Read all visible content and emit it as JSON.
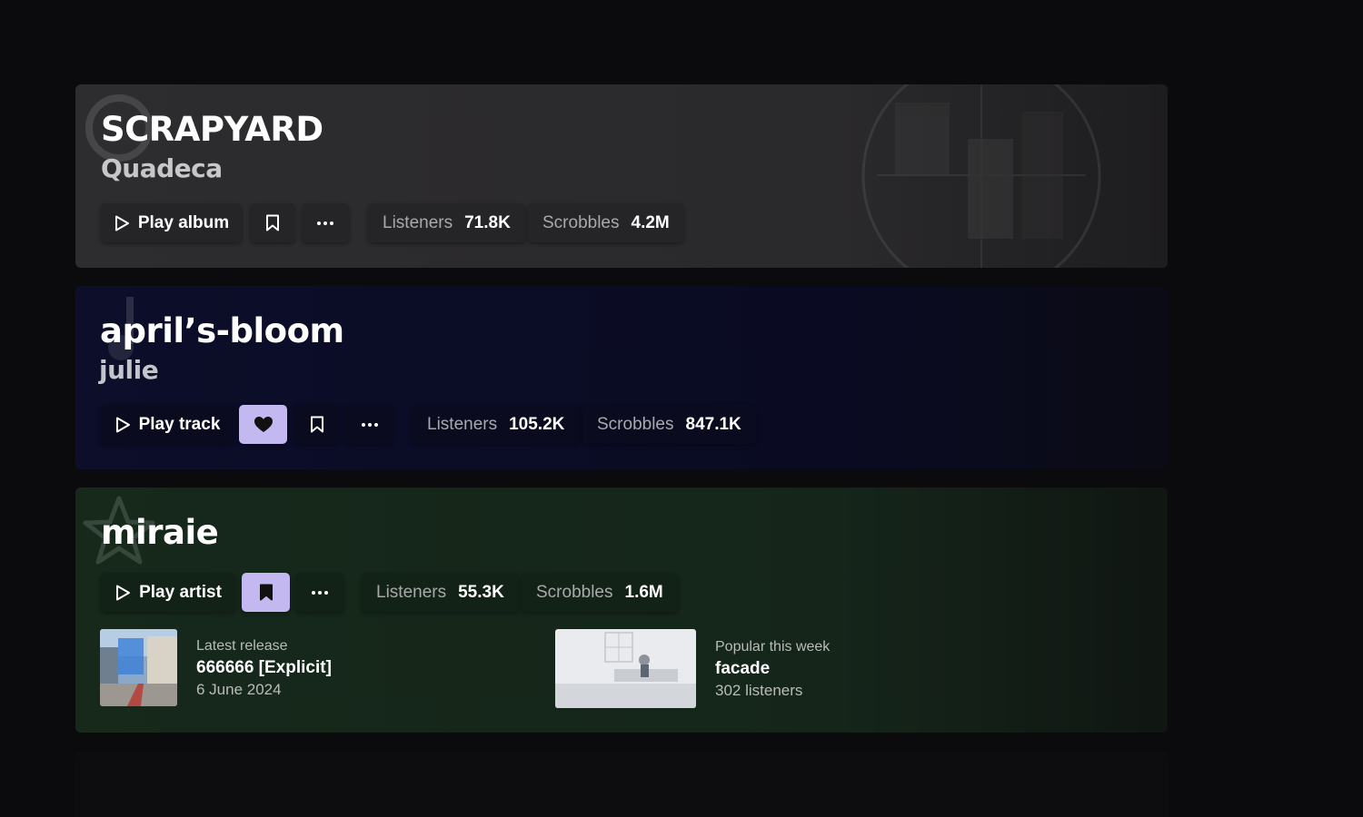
{
  "album_card": {
    "title": "SCRAPYARD",
    "artist": "Quadeca",
    "play_label": "Play album",
    "stats": [
      {
        "label": "Listeners",
        "value": "71.8K"
      },
      {
        "label": "Scrobbles",
        "value": "4.2M"
      }
    ],
    "icons": [
      "play-icon",
      "bookmark-icon",
      "more-icon"
    ]
  },
  "track_card": {
    "title": "april’s-bloom",
    "artist": "julie",
    "play_label": "Play track",
    "loved": true,
    "stats": [
      {
        "label": "Listeners",
        "value": "105.2K"
      },
      {
        "label": "Scrobbles",
        "value": "847.1K"
      }
    ],
    "icons": [
      "play-icon",
      "heart-icon",
      "bookmark-icon",
      "more-icon"
    ]
  },
  "artist_card": {
    "title": "miraie",
    "play_label": "Play artist",
    "bookmarked": true,
    "stats": [
      {
        "label": "Listeners",
        "value": "55.3K"
      },
      {
        "label": "Scrobbles",
        "value": "1.6M"
      }
    ],
    "latest_release": {
      "label": "Latest release",
      "name": "666666 [Explicit]",
      "date": "6 June 2024"
    },
    "popular": {
      "label": "Popular this week",
      "name": "facade",
      "listeners": "302 listeners"
    },
    "icons": [
      "play-icon",
      "bookmark-filled-icon",
      "more-icon",
      "star-icon"
    ]
  },
  "colors": {
    "background": "#0b0b0d",
    "accent": "#c4b8f0",
    "album_card": "#2d2c2e",
    "track_card": "#0c0e2a",
    "artist_card": "#16291b"
  }
}
